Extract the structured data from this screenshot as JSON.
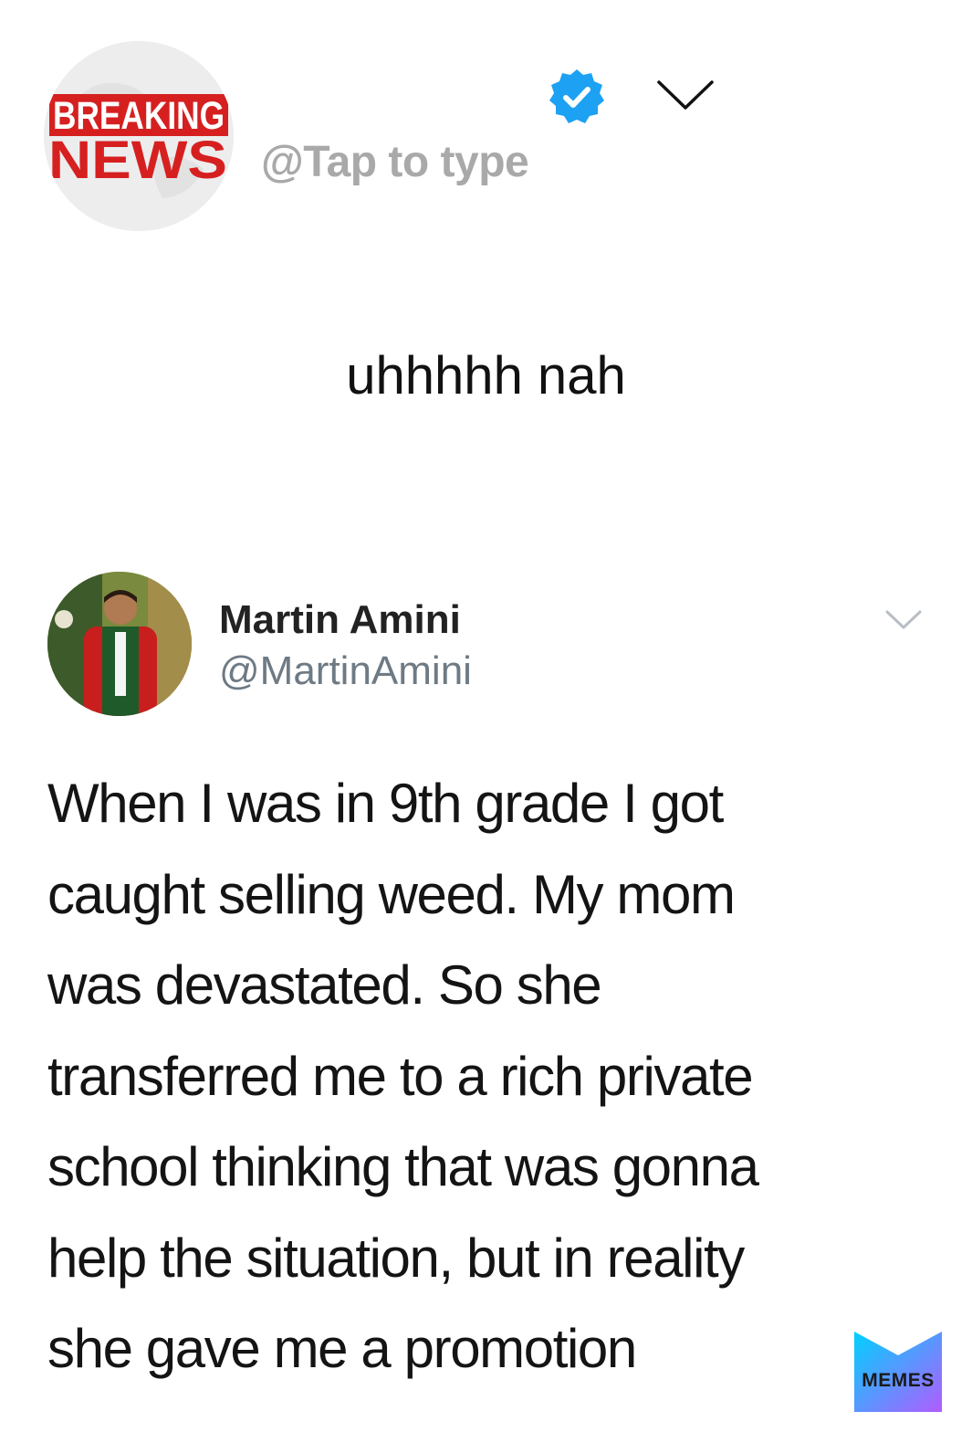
{
  "header": {
    "logo_line1": "BREAKING",
    "logo_line2": "NEWS",
    "handle": "@Tap to type",
    "verified_icon": "verified-badge-icon",
    "menu_icon": "chevron-down-icon"
  },
  "caption": "uhhhhh nah",
  "tweet": {
    "author_name": "Martin Amini",
    "author_handle": "@MartinAmini",
    "menu_icon": "chevron-down-icon",
    "lines": [
      "When I was in 9th grade I got",
      "caught selling weed. My mom",
      "was devastated. So she",
      "transferred me to a rich private",
      "school thinking that was gonna",
      "help the situation, but in reality",
      "she gave me a promotion"
    ]
  },
  "watermark": {
    "label": "MEMES",
    "icon": "memes-logo-icon"
  },
  "colors": {
    "verified_blue": "#1da1f2",
    "breaking_red": "#d62020",
    "handle_gray": "#a9a9a9",
    "tweet_handle_gray": "#6e7a84",
    "watermark_gradient_start": "#00d1ff",
    "watermark_gradient_end": "#b15cff"
  }
}
